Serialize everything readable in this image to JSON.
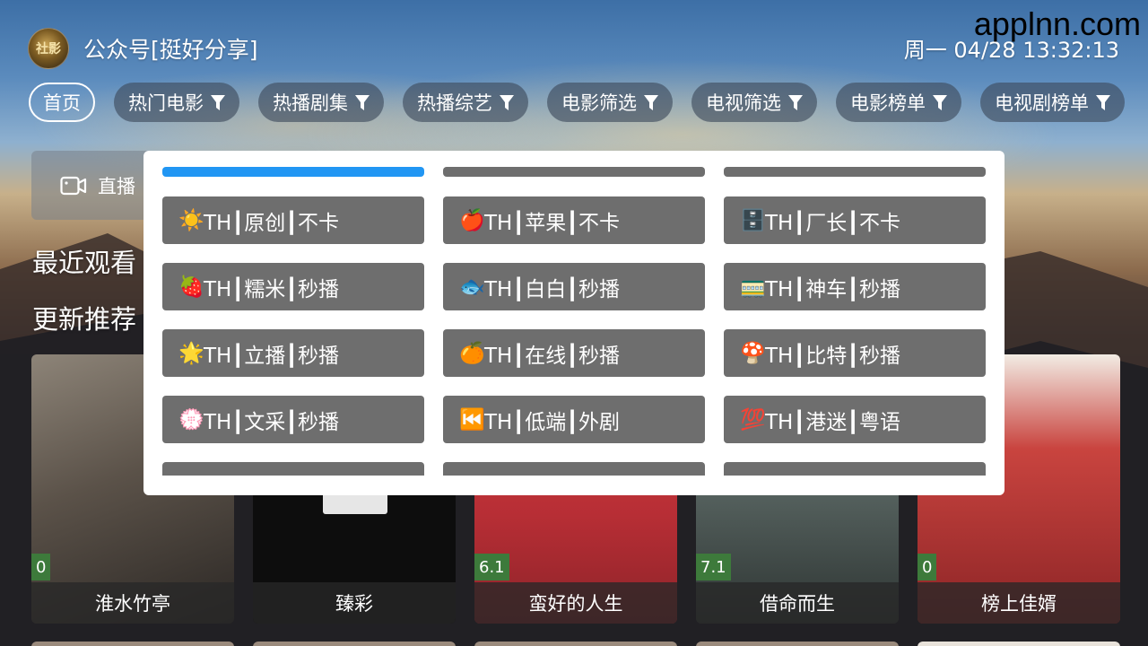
{
  "watermark": "applnn.com",
  "header": {
    "logo_text": "社影",
    "title": "公众号[挺好分享]",
    "datetime": "周一 04/28 13:32:13"
  },
  "tabs": [
    {
      "label": "首页",
      "active": true,
      "filter": false
    },
    {
      "label": "热门电影",
      "active": false,
      "filter": true
    },
    {
      "label": "热播剧集",
      "active": false,
      "filter": true
    },
    {
      "label": "热播综艺",
      "active": false,
      "filter": true
    },
    {
      "label": "电影筛选",
      "active": false,
      "filter": true
    },
    {
      "label": "电视筛选",
      "active": false,
      "filter": true
    },
    {
      "label": "电影榜单",
      "active": false,
      "filter": true
    },
    {
      "label": "电视剧榜单",
      "active": false,
      "filter": true
    }
  ],
  "live": {
    "label": "直播",
    "icon": "video-camera-icon"
  },
  "sections": {
    "recent": "最近观看",
    "updates": "更新推荐"
  },
  "posters": [
    {
      "title": "淮水竹亭",
      "rating": "0",
      "color": "#6f6a63"
    },
    {
      "title": "臻彩",
      "rating": "",
      "color": "#0c0c0c"
    },
    {
      "title": "蛮好的人生",
      "rating": "6.1",
      "color": "#c8353c"
    },
    {
      "title": "借命而生",
      "rating": "7.1",
      "color": "#4f5b59"
    },
    {
      "title": "榜上佳婿",
      "rating": "0",
      "color": "#9b2b2b"
    }
  ],
  "source_picker": {
    "sources": [
      {
        "emoji": "☀️",
        "label": "TH┃原创┃不卡"
      },
      {
        "emoji": "🍎",
        "label": "TH┃苹果┃不卡"
      },
      {
        "emoji": "🗄️",
        "label": "TH┃厂长┃不卡"
      },
      {
        "emoji": "🍓",
        "label": "TH┃糯米┃秒播"
      },
      {
        "emoji": "🐟",
        "label": "TH┃白白┃秒播"
      },
      {
        "emoji": "🚃",
        "label": "TH┃神车┃秒播"
      },
      {
        "emoji": "🌟",
        "label": "TH┃立播┃秒播"
      },
      {
        "emoji": "🍊",
        "label": "TH┃在线┃秒播"
      },
      {
        "emoji": "🍄",
        "label": "TH┃比特┃秒播"
      },
      {
        "emoji": "💮",
        "label": "TH┃文采┃秒播"
      },
      {
        "emoji": "⏮️",
        "label": "TH┃低端┃外剧"
      },
      {
        "emoji": "💯",
        "label": "TH┃港迷┃粤语"
      }
    ],
    "selected_accent": "#2196f3",
    "button_color": "#6e6e6e"
  }
}
